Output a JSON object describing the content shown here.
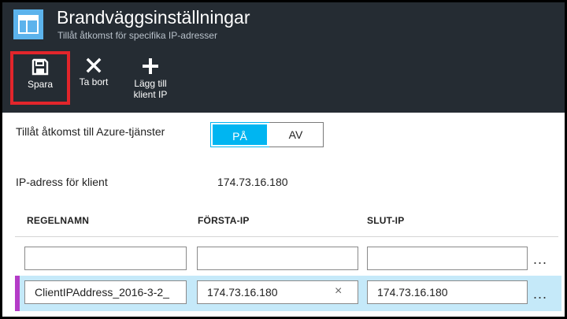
{
  "header": {
    "title": "Brandväggsinställningar",
    "subtitle": "Tillåt åtkomst för specifika IP-adresser",
    "icon": "firewall-window-icon",
    "background": "#252c33",
    "icon_color": "#5cb3ec"
  },
  "toolbar": {
    "save_label": "Spara",
    "delete_label": "Ta bort",
    "add_label_line1": "Lägg till",
    "add_label_line2": "klient IP",
    "highlight_color": "#e2252b"
  },
  "azure_access": {
    "label": "Tillåt åtkomst till Azure-tjänster",
    "on_label": "PÅ",
    "off_label": "AV",
    "selected": "PÅ",
    "accent": "#00b5f1"
  },
  "client_ip": {
    "label": "IP-adress för klient",
    "value": "174.73.16.180"
  },
  "rules": {
    "columns": [
      "REGELNAMN",
      "FÖRSTA-IP",
      "SLUT-IP"
    ],
    "rows": [
      {
        "rule_name": "",
        "start_ip": "",
        "end_ip": ""
      },
      {
        "rule_name": "ClientIPAddress_2016-3-2_",
        "start_ip": "174.73.16.180",
        "end_ip": "174.73.16.180"
      }
    ],
    "more_label": "...",
    "clear_label": "×",
    "selected_row_color": "#c5e9f9",
    "selected_marker_color": "#b43bc7"
  }
}
